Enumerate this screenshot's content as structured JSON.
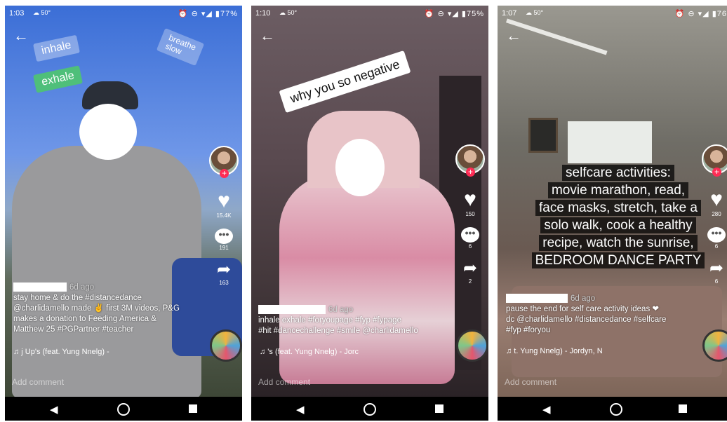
{
  "screens": [
    {
      "status_time": "1:03",
      "status_temp": "50°",
      "status_battery": "77%",
      "stickers": [
        "inhale",
        "exhale",
        "breathe slow"
      ],
      "likes": "15.4K",
      "comments": "191",
      "shares": "163",
      "time_ago": "6d ago",
      "caption": [
        "stay home & do the #distancedance",
        "@charlidamello made ✌ first 3M videos, P&G",
        "makes a donation to Feeding America &",
        "Matthew 25 #PGPartner #teacher"
      ],
      "music": "♫ j Up's (feat. Yung Nnelg) -",
      "add_comment": "Add comment"
    },
    {
      "status_time": "1:10",
      "status_temp": "50°",
      "status_battery": "75%",
      "overlay": "why you so negative",
      "likes": "150",
      "comments": "6",
      "shares": "2",
      "time_ago": "6d ago",
      "caption": [
        "inhale exhale #foryoupage #fyp #fypage",
        "#hit #dancechallenge #smile @charlidamello"
      ],
      "music": "♫ 's (feat. Yung Nnelg) - Jorc",
      "add_comment": "Add comment"
    },
    {
      "status_time": "1:07",
      "status_temp": "50°",
      "status_battery": "76",
      "overlay_lines": [
        "selfcare activities:",
        "movie marathon, read,",
        "face masks, stretch, take a",
        "solo walk, cook a healthy",
        "recipe, watch the sunrise,",
        "BEDROOM DANCE PARTY"
      ],
      "likes": "280",
      "comments": "6",
      "shares": "6",
      "time_ago": "6d ago",
      "caption": [
        "pause the end for self care activity ideas ❤",
        "dc @charlidamello #distancedance #selfcare",
        "#fyp #foryou"
      ],
      "music": "♫ t. Yung Nnelg) - Jordyn, N",
      "add_comment": "Add comment"
    }
  ],
  "icons": {
    "back": "arrow-left-icon",
    "like": "heart-icon",
    "comment": "comment-icon",
    "share": "share-icon",
    "nav_back": "triangle-back-icon",
    "nav_home": "circle-home-icon",
    "nav_recent": "square-recents-icon"
  },
  "colors": {
    "accent": "#fe2c55",
    "exhale_sticker": "#4fbf7a"
  }
}
